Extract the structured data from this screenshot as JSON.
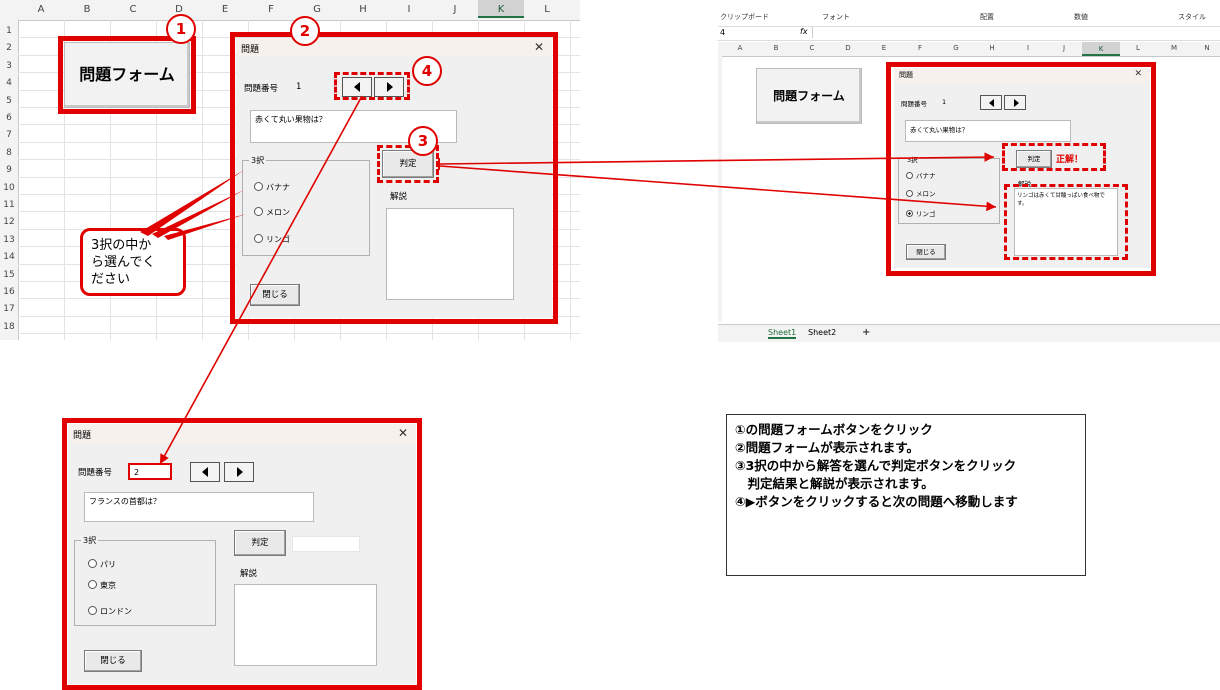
{
  "left_sheet": {
    "columns": [
      "A",
      "B",
      "C",
      "D",
      "E",
      "F",
      "G",
      "H",
      "I",
      "J",
      "K",
      "L"
    ],
    "selected_column": "K",
    "rows": [
      "1",
      "2",
      "3",
      "4",
      "5",
      "6",
      "7",
      "8",
      "9",
      "10",
      "11",
      "12",
      "13",
      "14",
      "15",
      "16",
      "17",
      "18"
    ],
    "form_button_label": "問題フォーム"
  },
  "form_q1": {
    "title": "問題",
    "close": "✕",
    "qnum_label": "問題番号",
    "qnum_value": "1",
    "question": "赤くて丸い果物は？",
    "frame_title": "3択",
    "options": [
      "バナナ",
      "メロン",
      "リンゴ"
    ],
    "judge_label": "判定",
    "explain_label": "解説",
    "close_label": "閉じる"
  },
  "form_q2": {
    "title": "問題",
    "close": "✕",
    "qnum_label": "問題番号",
    "qnum_value": "2",
    "question": "フランスの首都は？",
    "frame_title": "3択",
    "options": [
      "パリ",
      "東京",
      "ロンドン"
    ],
    "judge_label": "判定",
    "explain_label": "解説",
    "close_label": "閉じる"
  },
  "right_excel": {
    "ribbon_groups": [
      "クリップボード",
      "フォント",
      "配置",
      "数値",
      "スタイル"
    ],
    "namebox": "4",
    "fx": "fx",
    "columns": [
      "A",
      "B",
      "C",
      "D",
      "E",
      "F",
      "G",
      "H",
      "I",
      "J",
      "K",
      "L",
      "M",
      "N"
    ],
    "selected_column": "K",
    "form_button_label": "問題フォーム",
    "sheet_tabs": [
      "Sheet1",
      "Sheet2"
    ],
    "add_sheet": "+"
  },
  "form_result": {
    "title": "問題",
    "close": "✕",
    "qnum_label": "問題番号",
    "qnum_value": "1",
    "question": "赤くて丸い果物は？",
    "frame_title": "3択",
    "options": [
      "バナナ",
      "メロン",
      "リンゴ"
    ],
    "selected_option": 2,
    "judge_label": "判定",
    "result_text": "正解！",
    "explain_label": "解説",
    "explain_text": "リンゴは赤くて甘酸っぱい食べ物です。",
    "close_label": "閉じる"
  },
  "badges": [
    "1",
    "2",
    "3",
    "4"
  ],
  "callout_text": "3択の中か\nら選んでく\nださい",
  "instructions": [
    "①の問題フォームボタンをクリック",
    "②問題フォームが表示されます。",
    "③3択の中から解答を選んで判定ボタンをクリック",
    "　判定結果と解説が表示されます。",
    "④▶ボタンをクリックすると次の問題へ移動します"
  ],
  "colors": {
    "annotation_red": "#e00000",
    "form_bg": "#f0f0f0",
    "excel_green": "#217346"
  }
}
